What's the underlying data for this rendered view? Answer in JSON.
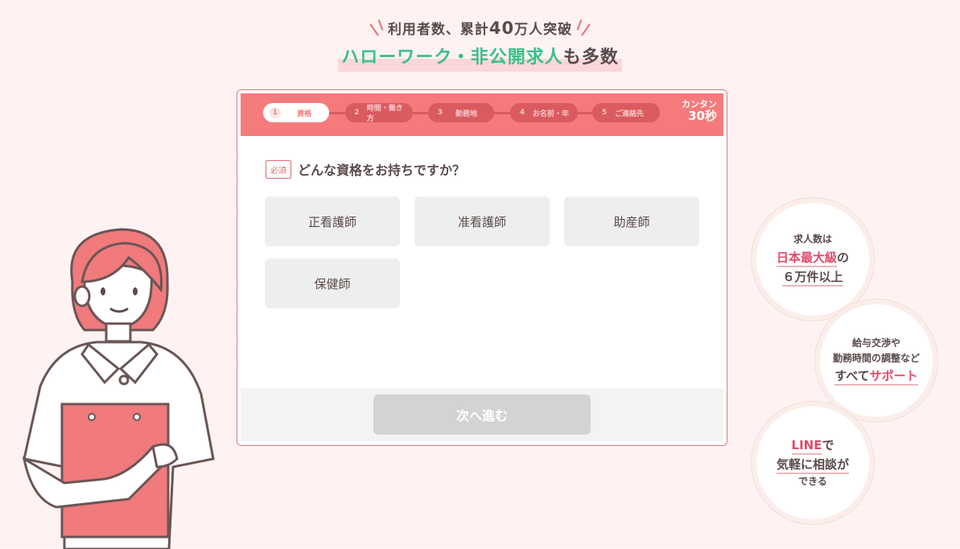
{
  "header": {
    "sub_prefix": "利用者数、累計",
    "sub_number": "40",
    "sub_suffix": "万人突破",
    "main_green": "ハローワーク・非公開求人",
    "main_tail": "も多数"
  },
  "steps": [
    {
      "num": "1",
      "label": "資格",
      "active": true
    },
    {
      "num": "2",
      "label": "時間・働き方",
      "active": false
    },
    {
      "num": "3",
      "label": "勤務地",
      "active": false
    },
    {
      "num": "4",
      "label": "お名前・年",
      "active": false
    },
    {
      "num": "5",
      "label": "ご連絡先",
      "active": false
    }
  ],
  "kantan": {
    "line1": "カンタン",
    "line2": "30秒"
  },
  "question": {
    "required_label": "必須",
    "text": "どんな資格をお持ちですか？"
  },
  "options": [
    "正看護師",
    "准看護師",
    "助産師",
    "保健師"
  ],
  "next_button": "次へ進む",
  "badges": {
    "b1": {
      "line1": "求人数は",
      "line2": "日本最大級",
      "line2_tail": "の",
      "line3": "６万件以上"
    },
    "b2": {
      "line1": "給与交渉や",
      "line2": "勤務時間の調整など",
      "line3_a": "すべて",
      "line3_b": "サポート"
    },
    "b3": {
      "line1_a": "LINE",
      "line1_b": "で",
      "line2": "気軽に相談が",
      "line3": "できる"
    }
  },
  "colors": {
    "accent": "#f57a7c",
    "green": "#3bbf8a",
    "pink_text": "#e04a68",
    "option_bg": "#eeeeee"
  }
}
